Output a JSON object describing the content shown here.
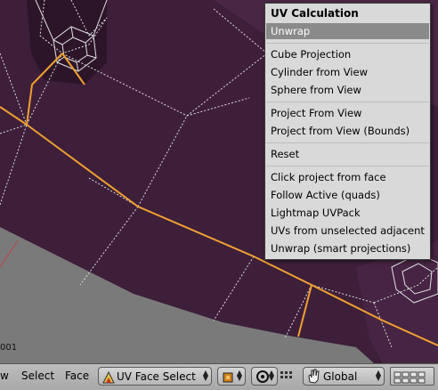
{
  "viewport": {
    "corner_label": "001",
    "background_color": "#7a7a7a",
    "mesh_color": "#3d1f3a",
    "edge_select_color": "#f0a030",
    "wire_color": "#e8e8e8"
  },
  "menu": {
    "title": "UV Calculation",
    "items": [
      "Unwrap",
      "Cube Projection",
      "Cylinder from View",
      "Sphere from View",
      "Project From View",
      "Project from View (Bounds)",
      "Reset",
      "Click project from face",
      "Follow Active (quads)",
      "Lightmap UVPack",
      "UVs from unselected adjacent",
      "Unwrap (smart projections)"
    ],
    "selected": "Unwrap"
  },
  "header": {
    "view_label": "w",
    "select_label": "Select",
    "face_label": "Face",
    "mode_dropdown": "UV Face Select",
    "orientation_dropdown": "Global",
    "icons": [
      "uv-face-select-icon",
      "shading-icon",
      "proportional-edit-icon",
      "snap-icon",
      "hand-transform-icon",
      "layers-grid-icon"
    ]
  }
}
